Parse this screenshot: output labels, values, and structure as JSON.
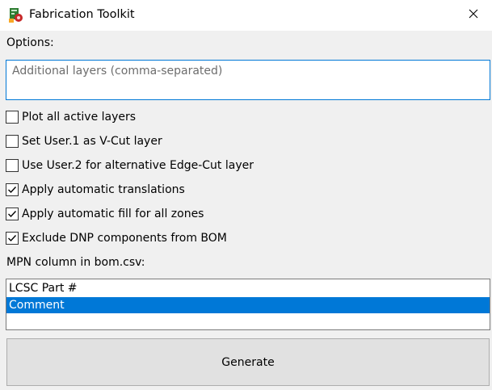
{
  "window": {
    "title": "Fabrication Toolkit",
    "app_icon": "fabrication-toolkit-icon",
    "close_icon": "close-icon"
  },
  "options": {
    "label": "Options:",
    "layers_placeholder": "Additional layers (comma-separated)",
    "layers_value": ""
  },
  "checkboxes": [
    {
      "label": "Plot all active layers",
      "checked": false
    },
    {
      "label": "Set User.1 as V-Cut layer",
      "checked": false
    },
    {
      "label": "Use User.2 for alternative Edge-Cut layer",
      "checked": false
    },
    {
      "label": "Apply automatic translations",
      "checked": true
    },
    {
      "label": "Apply automatic fill for all zones",
      "checked": true
    },
    {
      "label": "Exclude DNP components from BOM",
      "checked": true
    }
  ],
  "mpn": {
    "label": "MPN column in bom.csv:",
    "items": [
      {
        "label": "LCSC Part #",
        "selected": false
      },
      {
        "label": "Comment",
        "selected": true
      }
    ]
  },
  "generate_label": "Generate",
  "colors": {
    "accent": "#0078d7",
    "window_bg": "#f0f0f0",
    "button_bg": "#e1e1e1"
  }
}
